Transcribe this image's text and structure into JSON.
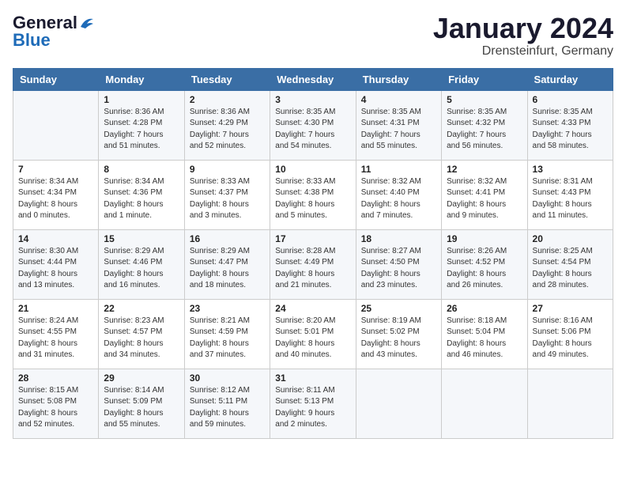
{
  "logo": {
    "general": "General",
    "blue": "Blue"
  },
  "header": {
    "title": "January 2024",
    "location": "Drensteinfurt, Germany"
  },
  "weekdays": [
    "Sunday",
    "Monday",
    "Tuesday",
    "Wednesday",
    "Thursday",
    "Friday",
    "Saturday"
  ],
  "weeks": [
    [
      {
        "day": "",
        "info": ""
      },
      {
        "day": "1",
        "info": "Sunrise: 8:36 AM\nSunset: 4:28 PM\nDaylight: 7 hours\nand 51 minutes."
      },
      {
        "day": "2",
        "info": "Sunrise: 8:36 AM\nSunset: 4:29 PM\nDaylight: 7 hours\nand 52 minutes."
      },
      {
        "day": "3",
        "info": "Sunrise: 8:35 AM\nSunset: 4:30 PM\nDaylight: 7 hours\nand 54 minutes."
      },
      {
        "day": "4",
        "info": "Sunrise: 8:35 AM\nSunset: 4:31 PM\nDaylight: 7 hours\nand 55 minutes."
      },
      {
        "day": "5",
        "info": "Sunrise: 8:35 AM\nSunset: 4:32 PM\nDaylight: 7 hours\nand 56 minutes."
      },
      {
        "day": "6",
        "info": "Sunrise: 8:35 AM\nSunset: 4:33 PM\nDaylight: 7 hours\nand 58 minutes."
      }
    ],
    [
      {
        "day": "7",
        "info": "Sunrise: 8:34 AM\nSunset: 4:34 PM\nDaylight: 8 hours\nand 0 minutes."
      },
      {
        "day": "8",
        "info": "Sunrise: 8:34 AM\nSunset: 4:36 PM\nDaylight: 8 hours\nand 1 minute."
      },
      {
        "day": "9",
        "info": "Sunrise: 8:33 AM\nSunset: 4:37 PM\nDaylight: 8 hours\nand 3 minutes."
      },
      {
        "day": "10",
        "info": "Sunrise: 8:33 AM\nSunset: 4:38 PM\nDaylight: 8 hours\nand 5 minutes."
      },
      {
        "day": "11",
        "info": "Sunrise: 8:32 AM\nSunset: 4:40 PM\nDaylight: 8 hours\nand 7 minutes."
      },
      {
        "day": "12",
        "info": "Sunrise: 8:32 AM\nSunset: 4:41 PM\nDaylight: 8 hours\nand 9 minutes."
      },
      {
        "day": "13",
        "info": "Sunrise: 8:31 AM\nSunset: 4:43 PM\nDaylight: 8 hours\nand 11 minutes."
      }
    ],
    [
      {
        "day": "14",
        "info": "Sunrise: 8:30 AM\nSunset: 4:44 PM\nDaylight: 8 hours\nand 13 minutes."
      },
      {
        "day": "15",
        "info": "Sunrise: 8:29 AM\nSunset: 4:46 PM\nDaylight: 8 hours\nand 16 minutes."
      },
      {
        "day": "16",
        "info": "Sunrise: 8:29 AM\nSunset: 4:47 PM\nDaylight: 8 hours\nand 18 minutes."
      },
      {
        "day": "17",
        "info": "Sunrise: 8:28 AM\nSunset: 4:49 PM\nDaylight: 8 hours\nand 21 minutes."
      },
      {
        "day": "18",
        "info": "Sunrise: 8:27 AM\nSunset: 4:50 PM\nDaylight: 8 hours\nand 23 minutes."
      },
      {
        "day": "19",
        "info": "Sunrise: 8:26 AM\nSunset: 4:52 PM\nDaylight: 8 hours\nand 26 minutes."
      },
      {
        "day": "20",
        "info": "Sunrise: 8:25 AM\nSunset: 4:54 PM\nDaylight: 8 hours\nand 28 minutes."
      }
    ],
    [
      {
        "day": "21",
        "info": "Sunrise: 8:24 AM\nSunset: 4:55 PM\nDaylight: 8 hours\nand 31 minutes."
      },
      {
        "day": "22",
        "info": "Sunrise: 8:23 AM\nSunset: 4:57 PM\nDaylight: 8 hours\nand 34 minutes."
      },
      {
        "day": "23",
        "info": "Sunrise: 8:21 AM\nSunset: 4:59 PM\nDaylight: 8 hours\nand 37 minutes."
      },
      {
        "day": "24",
        "info": "Sunrise: 8:20 AM\nSunset: 5:01 PM\nDaylight: 8 hours\nand 40 minutes."
      },
      {
        "day": "25",
        "info": "Sunrise: 8:19 AM\nSunset: 5:02 PM\nDaylight: 8 hours\nand 43 minutes."
      },
      {
        "day": "26",
        "info": "Sunrise: 8:18 AM\nSunset: 5:04 PM\nDaylight: 8 hours\nand 46 minutes."
      },
      {
        "day": "27",
        "info": "Sunrise: 8:16 AM\nSunset: 5:06 PM\nDaylight: 8 hours\nand 49 minutes."
      }
    ],
    [
      {
        "day": "28",
        "info": "Sunrise: 8:15 AM\nSunset: 5:08 PM\nDaylight: 8 hours\nand 52 minutes."
      },
      {
        "day": "29",
        "info": "Sunrise: 8:14 AM\nSunset: 5:09 PM\nDaylight: 8 hours\nand 55 minutes."
      },
      {
        "day": "30",
        "info": "Sunrise: 8:12 AM\nSunset: 5:11 PM\nDaylight: 8 hours\nand 59 minutes."
      },
      {
        "day": "31",
        "info": "Sunrise: 8:11 AM\nSunset: 5:13 PM\nDaylight: 9 hours\nand 2 minutes."
      },
      {
        "day": "",
        "info": ""
      },
      {
        "day": "",
        "info": ""
      },
      {
        "day": "",
        "info": ""
      }
    ]
  ]
}
